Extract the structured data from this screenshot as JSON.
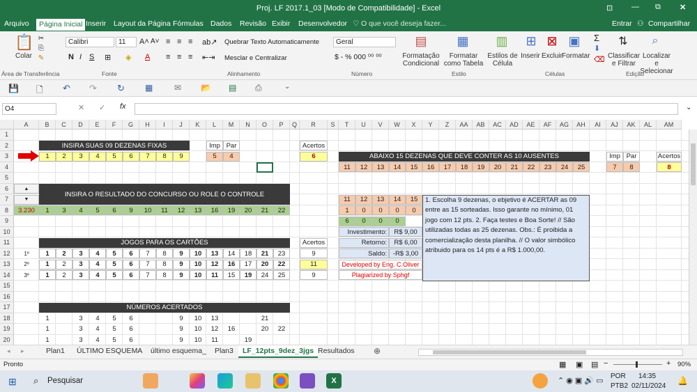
{
  "window": {
    "title": "Proj. LF 2017.1_03  [Modo de Compatibilidade] - Excel",
    "minimize": "—",
    "restore": "⧉",
    "close": "✕"
  },
  "menu": {
    "items": [
      "Arquivo",
      "Página Inicial",
      "Inserir",
      "Layout da Página",
      "Fórmulas",
      "Dados",
      "Revisão",
      "Exibir",
      "Desenvolvedor"
    ],
    "search": "O que você deseja fazer...",
    "enter": "Entrar",
    "share": "Compartilhar"
  },
  "ribbon": {
    "paste": "Colar",
    "font": "Calibri",
    "size": "11",
    "wrap": "Quebrar Texto Automaticamente",
    "merge": "Mesclar e Centralizar",
    "numfmt": "Geral",
    "cond": "Formatação Condicional",
    "fmttable": "Formatar como Tabela",
    "styles": "Estilos de Célula",
    "insert": "Inserir",
    "delete": "Excluir",
    "format": "Formatar",
    "sort": "Classificar e Filtrar",
    "find": "Localizar e Selecionar",
    "groups": [
      "Área de Transferência",
      "Fonte",
      "Alinhamento",
      "Número",
      "Estilo",
      "Células",
      "Edição"
    ]
  },
  "formula": {
    "namebox": "O4",
    "fx": "fx",
    "value": ""
  },
  "columns": [
    "A",
    "B",
    "C",
    "D",
    "E",
    "F",
    "G",
    "H",
    "I",
    "J",
    "K",
    "L",
    "M",
    "N",
    "O",
    "P",
    "Q",
    "R",
    "S",
    "T",
    "U",
    "V",
    "W",
    "X",
    "Y",
    "Z",
    "AA",
    "AB",
    "AC",
    "AD",
    "AE",
    "AF",
    "AG",
    "AH",
    "AI",
    "AJ",
    "AK",
    "AL",
    "AM"
  ],
  "rows": [
    "1",
    "2",
    "3",
    "4",
    "5",
    "6",
    "7",
    "8",
    "9",
    "10",
    "11",
    "12",
    "13",
    "14",
    "15",
    "16",
    "17",
    "18",
    "19",
    "20",
    "21",
    "22",
    "23"
  ],
  "sheet": {
    "fixed_title": "INSIRA SUAS 09 DEZENAS FIXAS",
    "fixed": [
      "1",
      "2",
      "3",
      "4",
      "5",
      "6",
      "7",
      "8",
      "9"
    ],
    "imp": "Imp",
    "par": "Par",
    "imp_v": "5",
    "par_v": "4",
    "acertos": "Acertos",
    "acertos_v": "6",
    "absent_title": "ABAIXO 15 DEZENAS QUE DEVE CONTER AS 10 AUSENTES",
    "absent": [
      "11",
      "12",
      "13",
      "14",
      "15",
      "16",
      "17",
      "18",
      "19",
      "20",
      "21",
      "22",
      "23",
      "24",
      "25"
    ],
    "imp2_v": "7",
    "par2_v": "8",
    "acertos2_v": "8",
    "result_title": "INSIRA O RESULTADO DO CONCURSO OU ROLE O CONTROLE",
    "contest": "3.230",
    "result": [
      "1",
      "3",
      "4",
      "5",
      "6",
      "9",
      "10",
      "11",
      "12",
      "13",
      "16",
      "19",
      "20",
      "21",
      "22"
    ],
    "games_title": "JOGOS PARA OS CARTÕES",
    "game_labels": [
      "1º",
      "2º",
      "3º"
    ],
    "games": [
      [
        "1",
        "2",
        "3",
        "4",
        "5",
        "6",
        "7",
        "8",
        "9",
        "10",
        "13",
        "14",
        "18",
        "21",
        "23"
      ],
      [
        "1",
        "2",
        "3",
        "4",
        "5",
        "6",
        "7",
        "8",
        "9",
        "10",
        "12",
        "16",
        "17",
        "20",
        "22"
      ],
      [
        "1",
        "2",
        "3",
        "4",
        "5",
        "6",
        "7",
        "8",
        "9",
        "10",
        "11",
        "15",
        "19",
        "24",
        "25"
      ]
    ],
    "game_bold": [
      [
        1,
        1,
        1,
        1,
        1,
        1,
        0,
        0,
        1,
        1,
        1,
        0,
        0,
        1,
        0
      ],
      [
        1,
        0,
        1,
        1,
        1,
        1,
        0,
        0,
        1,
        1,
        1,
        1,
        0,
        1,
        1
      ],
      [
        1,
        0,
        1,
        1,
        1,
        1,
        0,
        0,
        1,
        1,
        1,
        0,
        1,
        0,
        0
      ]
    ],
    "game_hits": [
      "9",
      "11",
      "9"
    ],
    "hits_title": "NÚMEROS ACERTADOS",
    "hits": [
      [
        "1",
        "",
        "3",
        "4",
        "5",
        "6",
        "",
        "",
        "9",
        "10",
        "13",
        "",
        "",
        "21",
        ""
      ],
      [
        "1",
        "",
        "3",
        "4",
        "5",
        "6",
        "",
        "",
        "9",
        "10",
        "12",
        "16",
        "",
        "20",
        "22"
      ],
      [
        "1",
        "",
        "3",
        "4",
        "5",
        "6",
        "",
        "",
        "9",
        "10",
        "11",
        "",
        "19",
        "",
        ""
      ]
    ],
    "mini_head": [
      "11",
      "12",
      "13",
      "14",
      "15"
    ],
    "mini_row": [
      "1",
      "0",
      "0",
      "0",
      "0"
    ],
    "mini_row2": [
      "6",
      "0",
      "0",
      "0"
    ],
    "invest": "Investimento:",
    "invest_v": "R$ 9,00",
    "retorno": "Retorno:",
    "retorno_v": "R$ 6,00",
    "saldo": "Saldo:",
    "saldo_v": "-R$ 3,00",
    "dev": "Developed by Eng. C.Oliver",
    "plag": "Plagiarized by Sphgf",
    "notes": "1. Escolha 9 dezenas, o ebjetivo é ACERTAR as 09 entre as 15 sorteadas. Isso garante no mínimo,  01 jogo com 12 pts. 2. Faça testes e Boa Sorte! // São utilizadas todas as 25 dezenas. Obs.: É proibida a comercialização desta planilha. // O valor simbólico atribuido para os 14 pts é a R$ 1.000,00."
  },
  "tabs": [
    "Plan1",
    "ÚLTIMO ESQUEMA",
    "último esquema_",
    "Plan3",
    "LF_12pts_9dez_3jgs",
    "Resultados"
  ],
  "active_tab": "LF_12pts_9dez_3jgs",
  "status": {
    "ready": "Pronto",
    "zoom": "90%"
  },
  "taskbar": {
    "search": "Pesquisar",
    "lang": "POR",
    "layout": "PTB2",
    "time": "14:35",
    "date": "02/11/2024"
  }
}
